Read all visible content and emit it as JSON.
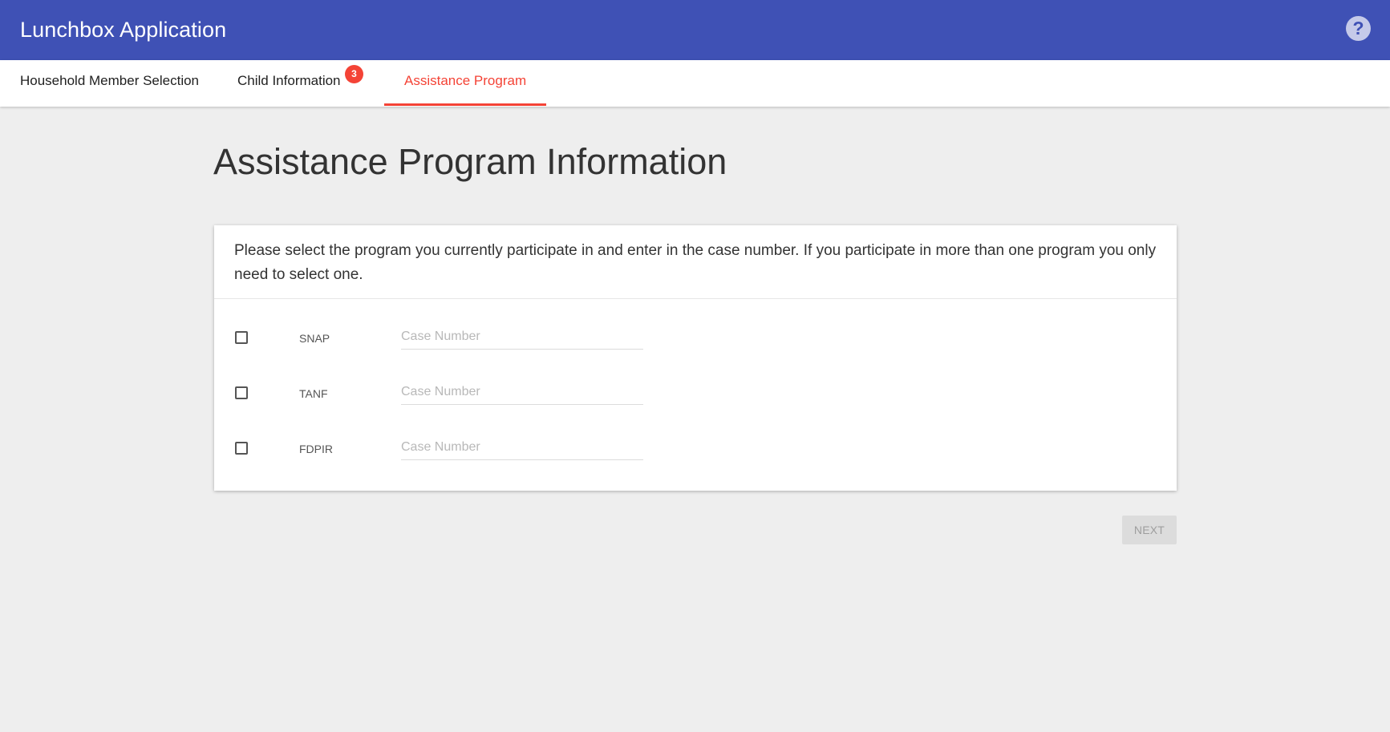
{
  "app": {
    "title": "Lunchbox Application",
    "help_glyph": "?"
  },
  "tabs": [
    {
      "label": "Household Member Selection",
      "active": false
    },
    {
      "label": "Child Information",
      "active": false,
      "badge": "3"
    },
    {
      "label": "Assistance Program",
      "active": true
    }
  ],
  "page": {
    "title": "Assistance Program Information"
  },
  "card": {
    "instructions": "Please select the program you currently participate in and enter in the case number. If you participate in more than one program you only need to select one.",
    "programs": [
      {
        "label": "SNAP",
        "checked": false,
        "placeholder": "Case Number",
        "value": ""
      },
      {
        "label": "TANF",
        "checked": false,
        "placeholder": "Case Number",
        "value": ""
      },
      {
        "label": "FDPIR",
        "checked": false,
        "placeholder": "Case Number",
        "value": ""
      }
    ]
  },
  "actions": {
    "next_label": "NEXT",
    "next_disabled": true
  },
  "colors": {
    "primary": "#3f51b5",
    "accent": "#f44336",
    "background": "#eeeeee"
  },
  "icons": {
    "help": "help-circle-icon"
  }
}
